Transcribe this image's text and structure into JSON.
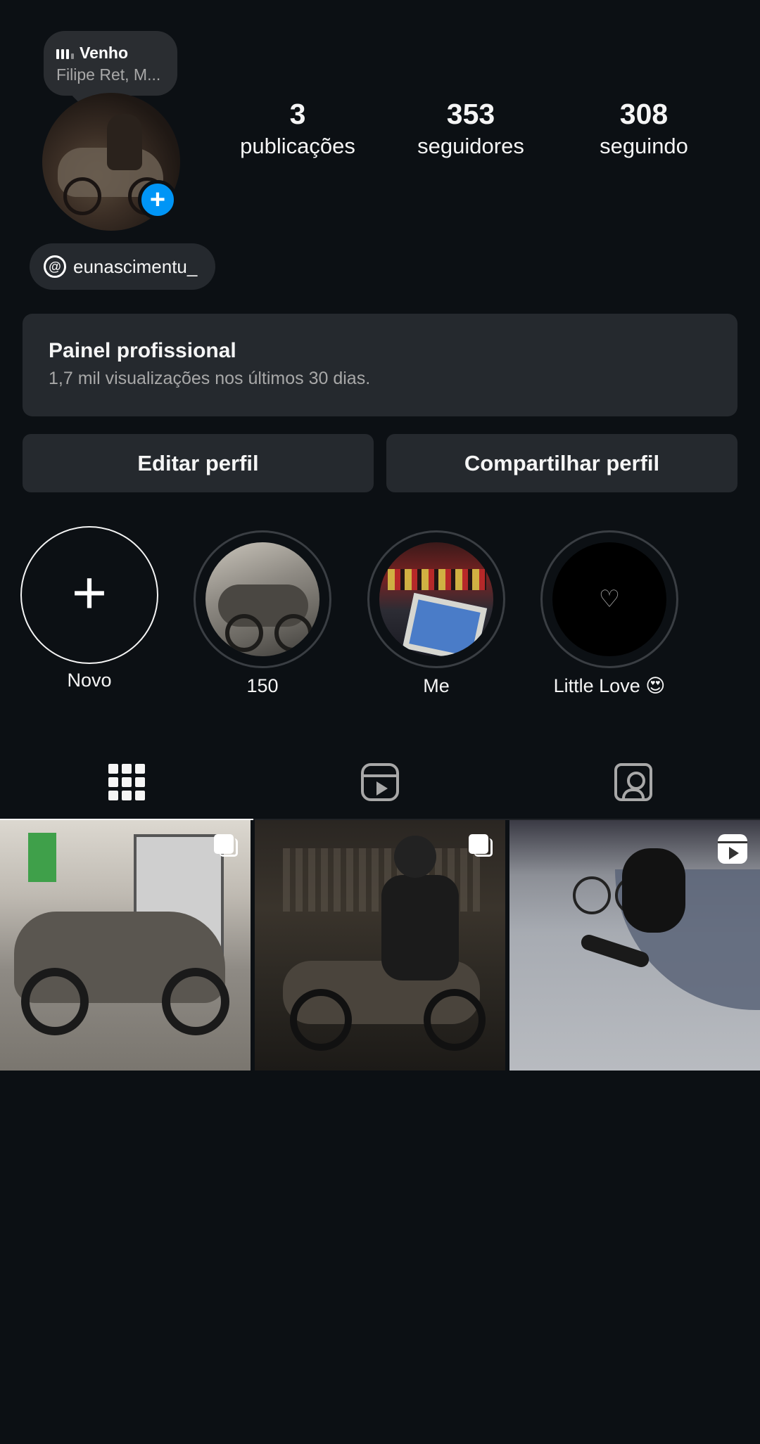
{
  "profile": {
    "music": {
      "title": "Venho",
      "artist": "Filipe Ret, M..."
    },
    "stats": [
      {
        "value": "3",
        "label": "publicações"
      },
      {
        "value": "353",
        "label": "seguidores"
      },
      {
        "value": "308",
        "label": "seguindo"
      }
    ],
    "threads_handle": "eunascimentu_",
    "add_badge": "+"
  },
  "pro_panel": {
    "title": "Painel profissional",
    "subtitle": "1,7 mil visualizações nos últimos 30 dias."
  },
  "buttons": {
    "edit": "Editar perfil",
    "share": "Compartilhar perfil"
  },
  "highlights": [
    {
      "label": "Novo",
      "icon": "plus-icon"
    },
    {
      "label": "150",
      "icon": "highlight-image"
    },
    {
      "label": "Me",
      "icon": "highlight-image"
    },
    {
      "label": "Little Love 😍",
      "icon": "heart-icon"
    }
  ],
  "tabs": [
    {
      "name": "posts-grid",
      "icon": "grid-icon",
      "active": true
    },
    {
      "name": "reels",
      "icon": "reels-icon",
      "active": false
    },
    {
      "name": "tagged",
      "icon": "tagged-person-icon",
      "active": false
    }
  ],
  "posts": [
    {
      "type": "carousel",
      "icon": "carousel-icon"
    },
    {
      "type": "carousel",
      "icon": "carousel-icon"
    },
    {
      "type": "reel",
      "icon": "reel-icon"
    }
  ],
  "colors": {
    "background": "#0c1014",
    "surface": "#25292e",
    "accent": "#0095f6",
    "text": "#f5f5f5",
    "muted": "#a8a8a8"
  }
}
